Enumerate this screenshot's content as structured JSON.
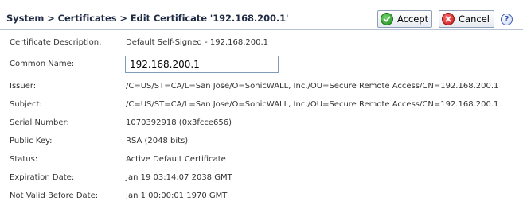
{
  "header": {
    "breadcrumb": "System > Certificates > Edit Certificate '192.168.200.1'",
    "accept_label": "Accept",
    "cancel_label": "Cancel",
    "help_label": "?"
  },
  "fields": {
    "description": {
      "label": "Certificate Description:",
      "value": "Default Self-Signed - 192.168.200.1"
    },
    "common_name": {
      "label": "Common Name:",
      "value": "192.168.200.1"
    },
    "issuer": {
      "label": "Issuer:",
      "value": "/C=US/ST=CA/L=San Jose/O=SonicWALL, Inc./OU=Secure Remote Access/CN=192.168.200.1"
    },
    "subject": {
      "label": "Subject:",
      "value": "/C=US/ST=CA/L=San Jose/O=SonicWALL, Inc./OU=Secure Remote Access/CN=192.168.200.1"
    },
    "serial": {
      "label": "Serial Number:",
      "value": "1070392918 (0x3fcce656)"
    },
    "public_key": {
      "label": "Public Key:",
      "value": "RSA (2048 bits)"
    },
    "status": {
      "label": "Status:",
      "value": "Active Default Certificate"
    },
    "expiration": {
      "label": "Expiration Date:",
      "value": "Jan 19 03:14:07 2038 GMT"
    },
    "not_before": {
      "label": "Not Valid Before Date:",
      "value": "Jan 1 00:00:01 1970 GMT"
    }
  },
  "colors": {
    "accept": "#1f8f1c",
    "cancel": "#c01818",
    "header_text": "#1f2a44"
  }
}
